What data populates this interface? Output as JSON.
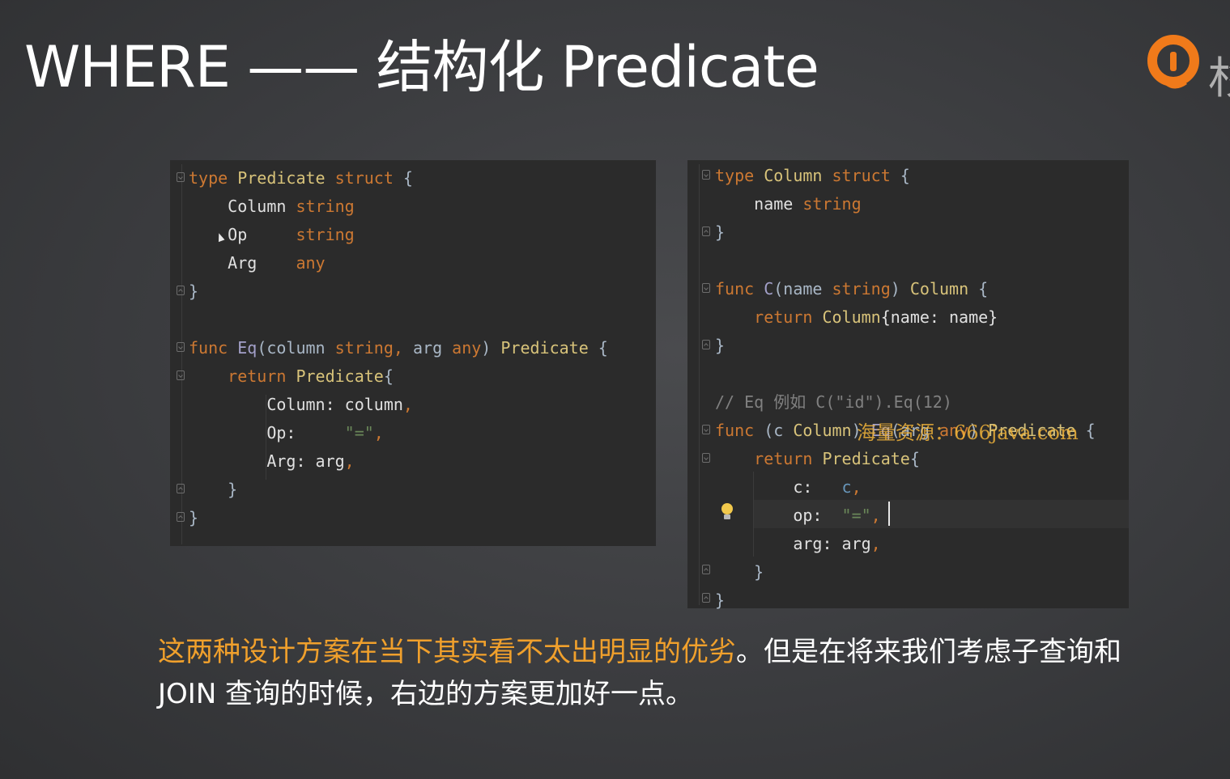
{
  "slide": {
    "title": "WHERE —— 结构化 Predicate",
    "logo_icon": "brand-logo-icon",
    "logo_letter": "杉"
  },
  "left_code": {
    "lines": [
      [
        "type",
        " ",
        "Predicate",
        " ",
        "struct",
        " {"
      ],
      [
        "    Column",
        " ",
        "string"
      ],
      [
        "    Op",
        "     ",
        "string"
      ],
      [
        "    Arg",
        "    ",
        "any"
      ],
      [
        "}"
      ],
      [
        ""
      ],
      [
        "func",
        " ",
        "Eq",
        "(column ",
        "string",
        ", ",
        "arg ",
        "any",
        ") ",
        "Predicate",
        " {"
      ],
      [
        "    ",
        "return",
        " ",
        "Predicate",
        "{"
      ],
      [
        "        Column: column",
        ","
      ],
      [
        "        Op:     ",
        "\"=\"",
        ","
      ],
      [
        "        Arg: arg",
        ","
      ],
      [
        "    }"
      ],
      [
        "}"
      ]
    ]
  },
  "right_code": {
    "lines": [
      [
        "type",
        " ",
        "Column",
        " ",
        "struct",
        " {"
      ],
      [
        "    name",
        " ",
        "string"
      ],
      [
        "}"
      ],
      [
        ""
      ],
      [
        "func",
        " ",
        "C",
        "(name ",
        "string",
        ") ",
        "Column",
        " {"
      ],
      [
        "    ",
        "return",
        " ",
        "Column",
        "{name: name}"
      ],
      [
        "}"
      ],
      [
        ""
      ],
      [
        "// Eq 例如 C(\"id\").Eq(12)"
      ],
      [
        "func",
        " (c ",
        "Column",
        ") ",
        "Eq",
        "(arg ",
        "any",
        ") ",
        "Predicate",
        " {"
      ],
      [
        "    ",
        "return",
        " ",
        "Predicate",
        "{"
      ],
      [
        "        c:   ",
        "c",
        ","
      ],
      [
        "        op:  ",
        "\"=\"",
        ","
      ],
      [
        "        arg: arg",
        ","
      ],
      [
        "    }"
      ],
      [
        "}"
      ]
    ]
  },
  "watermark": "海量资源：666java.com",
  "caption": {
    "highlight": "这两种设计方案在当下其实看不太出明显的优劣",
    "rest_line1": "。但是在将来我们考虑子查询和",
    "line2": "JOIN 查询的时候，右边的方案更加好一点。"
  },
  "colors": {
    "keyword": "#cc7832",
    "type": "#d8c37a",
    "string": "#6a8759",
    "comment": "#808080",
    "caption_highlight": "#f0a02c",
    "logo_orange": "#f07a1a"
  }
}
